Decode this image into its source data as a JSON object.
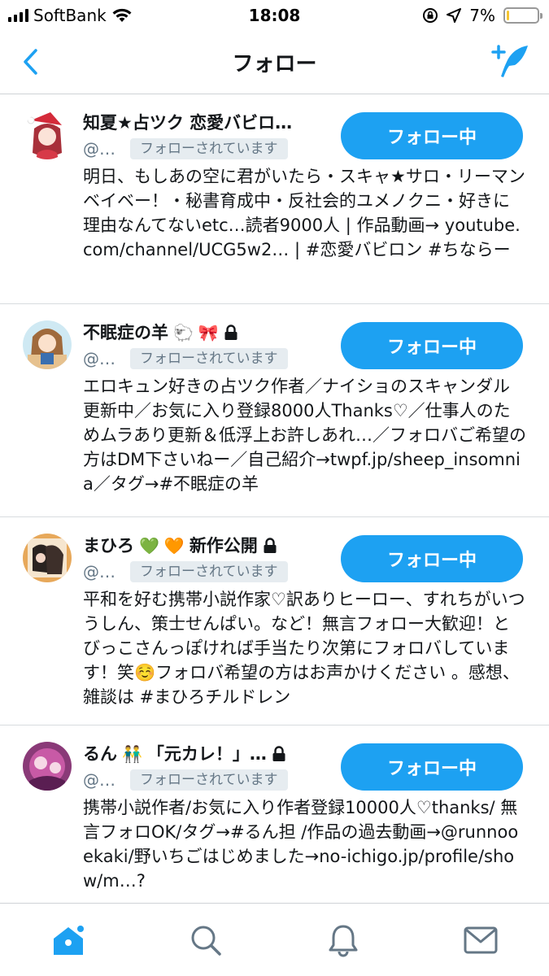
{
  "status_bar": {
    "carrier": "SoftBank",
    "time": "18:08",
    "battery_percent": "7%",
    "battery_level": 0.07,
    "icons": [
      "signal-icon",
      "wifi-icon",
      "orientation-lock-icon",
      "location-icon",
      "battery-icon"
    ]
  },
  "nav": {
    "title": "フォロー",
    "back_icon": "chevron-left-icon",
    "compose_icon": "compose-tweet-icon"
  },
  "accent": "#1da1f2",
  "users": [
    {
      "name": "知夏★占ツク 恋愛バビロ…",
      "handle": "@…",
      "follows_you": "フォローされています",
      "follow_label": "フォロー中",
      "locked": false,
      "emojis": [],
      "bio": "明日、もしあの空に君がいたら・スキャ★サロ・リーマンベイベー！・秘書育成中・反社会的ユメノクニ・好きに理由なんてないetc…読者9000人 | 作品動画→ youtube.com/channel/UCG5w2… | #恋愛バビロン #ちならー"
    },
    {
      "name": "不眠症の羊",
      "handle": "@…",
      "follows_you": "フォローされています",
      "follow_label": "フォロー中",
      "locked": true,
      "emojis": [
        "🐑",
        "🎀"
      ],
      "bio": "エロキュン好きの占ツク作者／ナイショのスキャンダル更新中／お気に入り登録8000人Thanks♡／仕事人のためムラあり更新＆低浮上お許しあれ…／フォロバご希望の方はDM下さいねー／自己紹介→twpf.jp/sheep_insomnia／タグ→#不眠症の羊"
    },
    {
      "name": "まひろ",
      "name_suffix": "新作公開",
      "handle": "@…",
      "follows_you": "フォローされています",
      "follow_label": "フォロー中",
      "locked": true,
      "emojis": [
        "💚",
        "🧡"
      ],
      "bio": "平和を好む携帯小説作家♡訳ありヒーロー、すれちがいつうしん、策士せんぱい。など！無言フォロー大歓迎！とびっこさんっぽければ手当たり次第にフォロバしています！笑☺️フォロバ希望の方はお声かけください 。感想、雑談は #まひろチルドレン"
    },
    {
      "name": "るん",
      "name_suffix": "「元カレ！」…",
      "handle": "@…",
      "follows_you": "フォローされています",
      "follow_label": "フォロー中",
      "locked": true,
      "emojis": [
        "👬"
      ],
      "bio": "携帯小説作者/お気に入り作者登録10000人♡thanks/ 無言フォロOK/タグ→#るん担 /作品の過去動画→@runnooekaki/野いちごはじめました→no-ichigo.jp/profile/show/m…?"
    }
  ],
  "tabs": [
    "home-icon",
    "search-icon",
    "notifications-icon",
    "messages-icon"
  ]
}
